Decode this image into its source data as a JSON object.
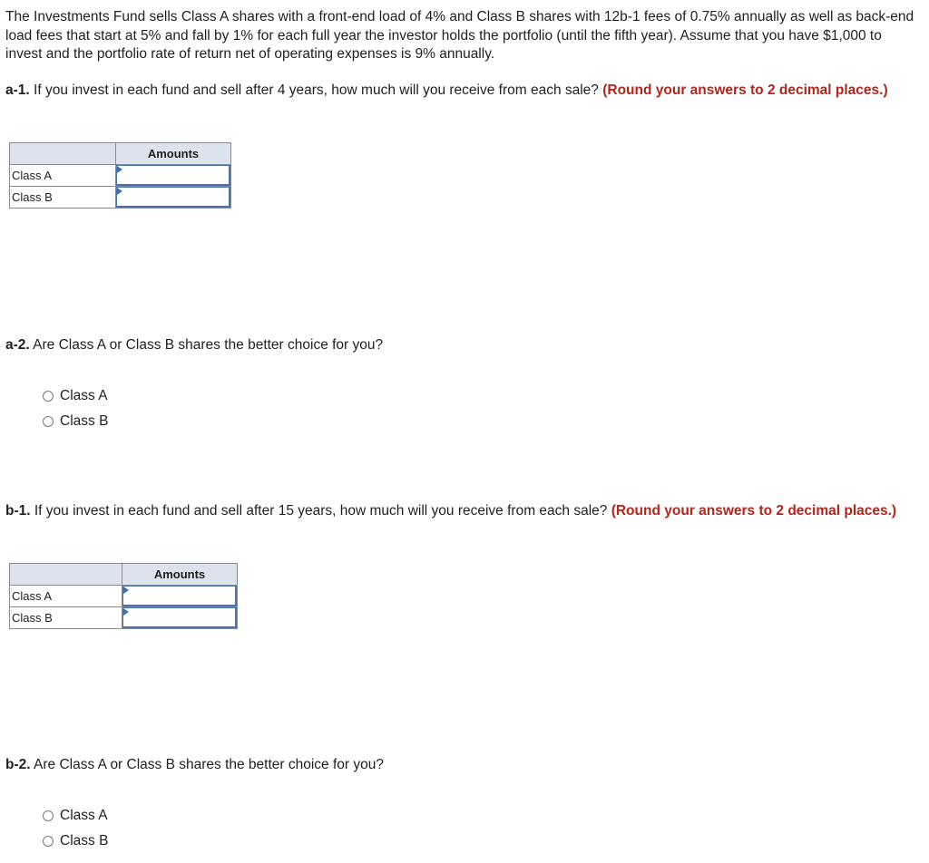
{
  "intro": "The Investments Fund sells Class A shares with a front-end load of 4% and Class B shares with 12b-1 fees of 0.75% annually as well as back-end load fees that start at 5% and fall by 1% for each full year the investor holds the portfolio (until the fifth year). Assume that you have $1,000 to invest and the portfolio rate of return net of operating expenses is 9% annually.",
  "a1": {
    "label": "a-1.",
    "question": " If you invest in each fund and sell after 4 years, how much will you receive from each sale? ",
    "instruction": "(Round your answers to 2 decimal places.)",
    "table": {
      "header": "Amounts",
      "rows": [
        {
          "label": "Class A",
          "value": ""
        },
        {
          "label": "Class B",
          "value": ""
        }
      ]
    }
  },
  "a2": {
    "label": "a-2.",
    "question": " Are Class A or Class B shares the better choice for you?",
    "options": [
      "Class A",
      "Class B"
    ]
  },
  "b1": {
    "label": "b-1.",
    "question": " If you invest in each fund and sell after 15 years, how much will you receive from each sale? ",
    "instruction": "(Round your answers to 2 decimal places.)",
    "table": {
      "header": "Amounts",
      "rows": [
        {
          "label": "Class A",
          "value": ""
        },
        {
          "label": "Class B",
          "value": ""
        }
      ]
    }
  },
  "b2": {
    "label": "b-2.",
    "question": " Are Class A or Class B shares the better choice for you?",
    "options": [
      "Class A",
      "Class B"
    ]
  }
}
